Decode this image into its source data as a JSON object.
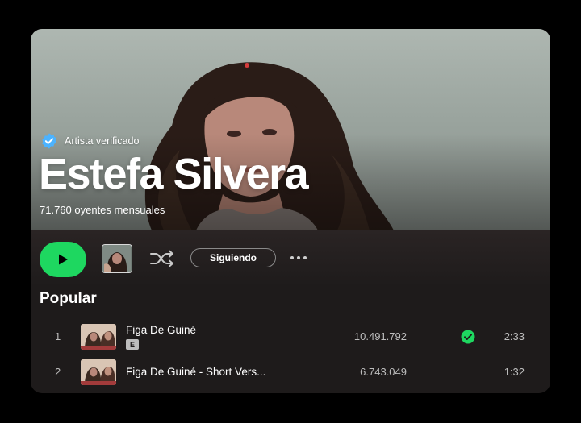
{
  "artist": {
    "verified_label": "Artista verificado",
    "name": "Estefa Silvera",
    "monthly_listeners": "71.760 oyentes mensuales"
  },
  "controls": {
    "follow_label": "Siguiendo"
  },
  "popular": {
    "title": "Popular",
    "tracks": [
      {
        "number": "1",
        "title": "Figa De Guiné",
        "explicit": "E",
        "plays": "10.491.792",
        "saved": true,
        "duration": "2:33"
      },
      {
        "number": "2",
        "title": "Figa De Guiné - Short Vers...",
        "plays": "6.743.049",
        "saved": false,
        "duration": "1:32"
      }
    ]
  },
  "colors": {
    "accent_green": "#1ed760",
    "verified_blue": "#4cb3ff",
    "background": "#1e1b1b"
  },
  "icons": [
    "verified-badge-icon",
    "play-icon",
    "shuffle-icon",
    "more-options-icon",
    "saved-check-icon"
  ]
}
